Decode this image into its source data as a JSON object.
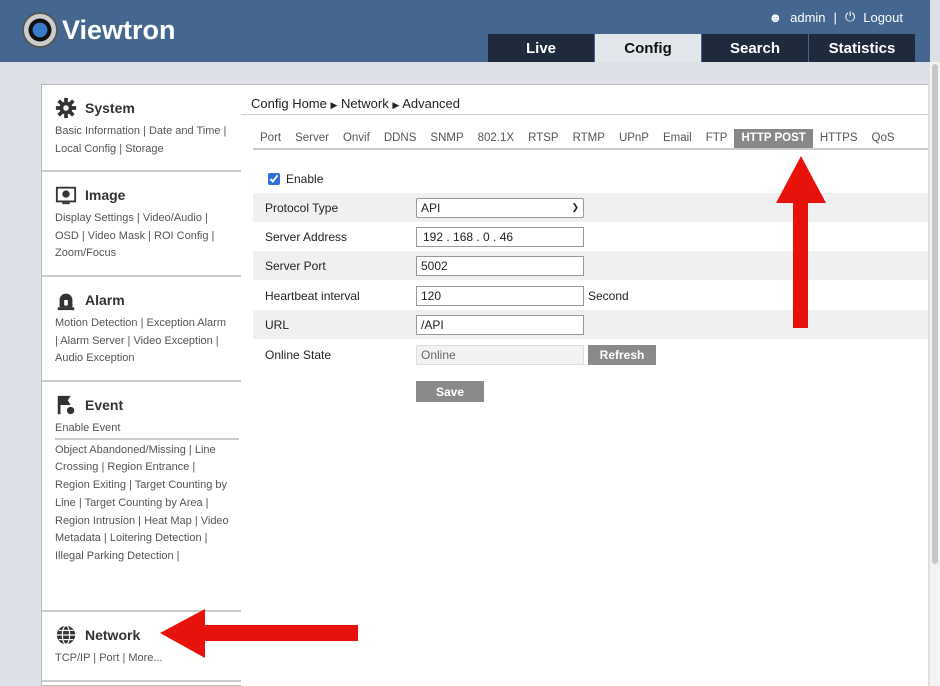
{
  "app": {
    "brand": "Viewtron",
    "user": "admin",
    "logout": "Logout"
  },
  "nav": [
    {
      "label": "Live"
    },
    {
      "label": "Config",
      "active": true
    },
    {
      "label": "Search"
    },
    {
      "label": "Statistics"
    }
  ],
  "sidebar": [
    {
      "title": "System",
      "icon": "gear-icon",
      "links": "Basic Information | Date and Time | Local Config | Storage"
    },
    {
      "title": "Image",
      "icon": "image-icon",
      "links": "Display Settings | Video/Audio | OSD | Video Mask | ROI Config | Zoom/Focus"
    },
    {
      "title": "Alarm",
      "icon": "alarm-icon",
      "links": "Motion Detection | Exception Alarm | Alarm Server | Video Exception | Audio Exception"
    },
    {
      "title": "Event",
      "icon": "event-icon",
      "sub": "Enable Event",
      "links": "Object Abandoned/Missing | Line Crossing | Region Entrance | Region Exiting | Target Counting by Line | Target Counting by Area | Region Intrusion | Heat Map | Video Metadata | Loitering Detection | Illegal Parking Detection |"
    },
    {
      "title": "Network",
      "icon": "globe-icon",
      "links": "TCP/IP | Port | More..."
    }
  ],
  "breadcrumb": [
    "Config Home",
    "Network",
    "Advanced"
  ],
  "tabs": [
    "Port",
    "Server",
    "Onvif",
    "DDNS",
    "SNMP",
    "802.1X",
    "RTSP",
    "RTMP",
    "UPnP",
    "Email",
    "FTP",
    "HTTP POST",
    "HTTPS",
    "QoS"
  ],
  "active_tab": "HTTP POST",
  "form": {
    "enable_label": "Enable",
    "enabled": true,
    "protocol_label": "Protocol Type",
    "protocol_value": "API",
    "address_label": "Server Address",
    "address_value": "192 . 168 . 0 . 46",
    "port_label": "Server Port",
    "port_value": "5002",
    "heartbeat_label": "Heartbeat interval",
    "heartbeat_value": "120",
    "heartbeat_unit": "Second",
    "url_label": "URL",
    "url_value": "/API",
    "state_label": "Online State",
    "state_value": "Online",
    "refresh": "Refresh",
    "save": "Save"
  },
  "annotation_color": "#e8120c"
}
